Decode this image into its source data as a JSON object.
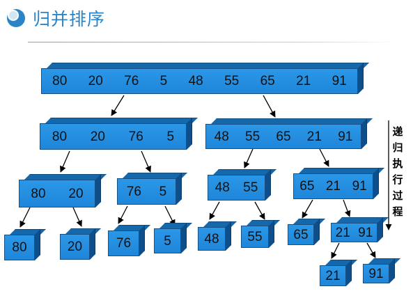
{
  "title": "归并排序",
  "side_label": "递归执行过程",
  "colors": {
    "title": "#2c84c8",
    "box_face": "#2190e0",
    "box_edge": "#1668ad",
    "accent_circle": "#2c84c8"
  },
  "icons": {
    "title_mark": "blue-circle-icon"
  },
  "tree": {
    "root": [
      "80",
      "20",
      "76",
      "5",
      "48",
      "55",
      "65",
      "21",
      "91"
    ],
    "level1": [
      [
        "80",
        "20",
        "76",
        "5"
      ],
      [
        "48",
        "55",
        "65",
        "21",
        "91"
      ]
    ],
    "level2": [
      [
        "80",
        "20"
      ],
      [
        "76",
        "5"
      ],
      [
        "48",
        "55"
      ],
      [
        "65",
        "21",
        "91"
      ]
    ],
    "level3": [
      [
        "80"
      ],
      [
        "20"
      ],
      [
        "76"
      ],
      [
        "5"
      ],
      [
        "48"
      ],
      [
        "55"
      ],
      [
        "65"
      ],
      [
        "21",
        "91"
      ]
    ],
    "level4": [
      [
        "21"
      ],
      [
        "91"
      ]
    ]
  }
}
